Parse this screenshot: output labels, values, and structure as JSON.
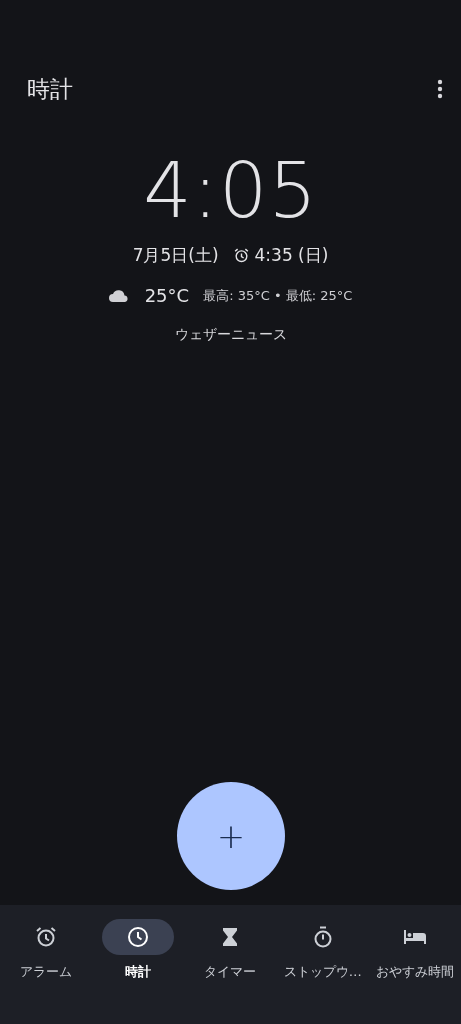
{
  "app_bar": {
    "title": "時計"
  },
  "clock": {
    "time": "4:05",
    "date": "7月5日(土)",
    "next_alarm": "4:35 (日)"
  },
  "weather": {
    "temperature": "25°C",
    "range": "最高: 35°C • 最低: 25°C",
    "link": "ウェザーニュース"
  },
  "fab": {
    "label": "+"
  },
  "tabs": [
    {
      "kind": "alarm",
      "label": "アラーム",
      "selected": false
    },
    {
      "kind": "clock",
      "label": "時計",
      "selected": true
    },
    {
      "kind": "timer",
      "label": "タイマー",
      "selected": false
    },
    {
      "kind": "stopwatch",
      "label": "ストップウ…",
      "selected": false
    },
    {
      "kind": "bedtime",
      "label": "おやすみ時間",
      "selected": false
    }
  ]
}
